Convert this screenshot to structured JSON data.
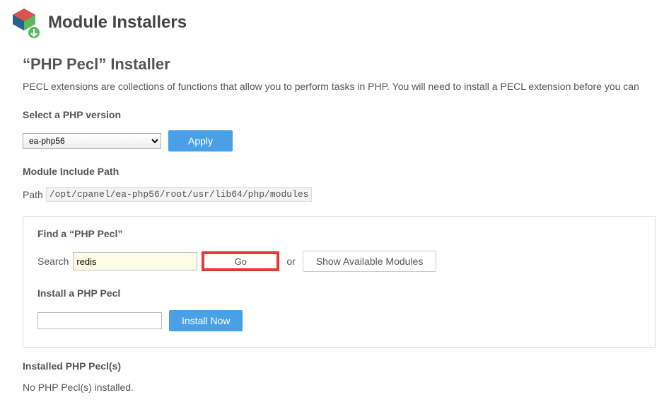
{
  "header": {
    "title": "Module Installers"
  },
  "installer": {
    "heading": "“PHP Pecl” Installer",
    "description": "PECL extensions are collections of functions that allow you to perform tasks in PHP. You will need to install a PECL extension before you can"
  },
  "version": {
    "label": "Select a PHP version",
    "selected": "ea-php56",
    "apply": "Apply"
  },
  "modulePath": {
    "label": "Module Include Path",
    "pathLabel": "Path",
    "pathValue": "/opt/cpanel/ea-php56/root/usr/lib64/php/modules"
  },
  "find": {
    "label": "Find a “PHP Pecl”",
    "searchLabel": "Search",
    "searchValue": "redis",
    "go": "Go",
    "or": "or",
    "showModules": "Show Available Modules"
  },
  "install": {
    "label": "Install a PHP Pecl",
    "installValue": "",
    "button": "Install Now"
  },
  "installed": {
    "label": "Installed PHP Pecl(s)",
    "message": "No PHP Pecl(s) installed."
  }
}
